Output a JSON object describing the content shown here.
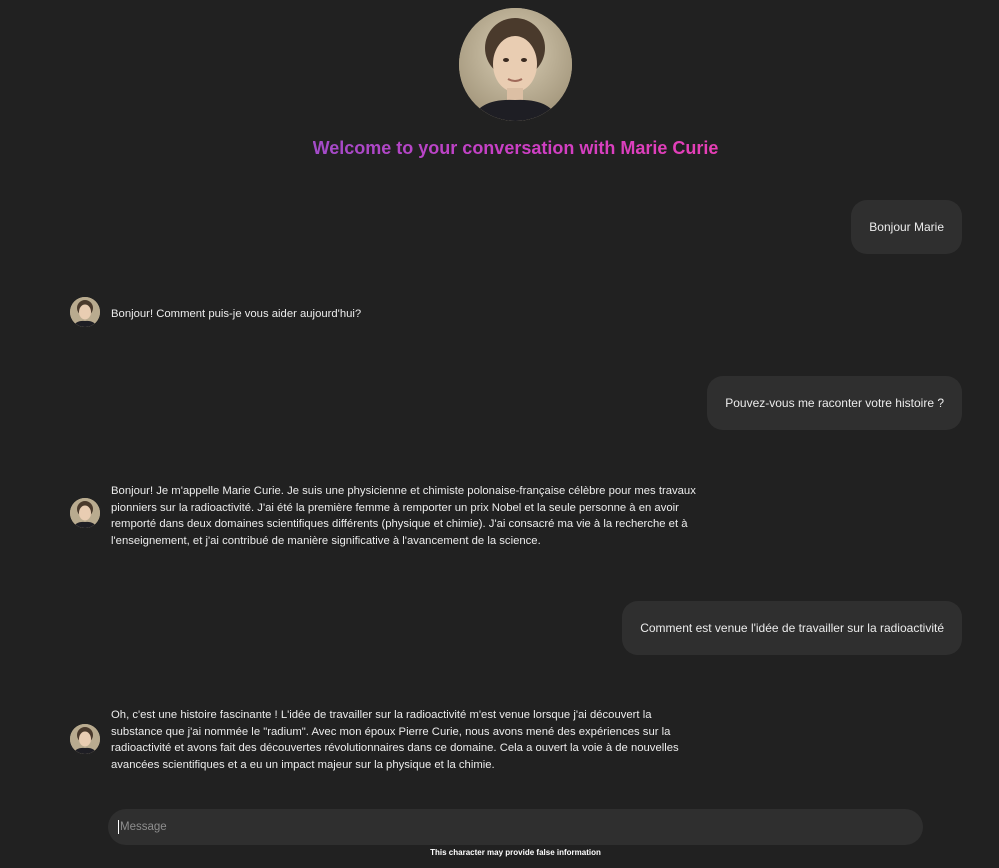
{
  "header": {
    "title": "Welcome to your conversation with Marie Curie",
    "avatar_icon": "portrait-avatar",
    "title_gradient": [
      "#a24bc8",
      "#e83fb6"
    ]
  },
  "messages": [
    {
      "role": "user",
      "text": "Bonjour Marie"
    },
    {
      "role": "assistant",
      "text": "Bonjour! Comment puis-je vous aider aujourd'hui?"
    },
    {
      "role": "user",
      "text": "Pouvez-vous me raconter votre histoire ?"
    },
    {
      "role": "assistant",
      "text": "Bonjour! Je m'appelle Marie Curie. Je suis une physicienne et chimiste polonaise-française célèbre pour mes travaux pionniers sur la radioactivité. J'ai été la première femme à remporter un prix Nobel et la seule personne à en avoir remporté dans deux domaines scientifiques différents (physique et chimie). J'ai consacré ma vie à la recherche et à l'enseignement, et j'ai contribué de manière significative à l'avancement de la science."
    },
    {
      "role": "user",
      "text": "Comment est venue l'idée de travailler sur la radioactivité"
    },
    {
      "role": "assistant",
      "text": "Oh, c'est une histoire fascinante ! L'idée de travailler sur la radioactivité m'est venue lorsque j'ai découvert la substance que j'ai nommée le \"radium\". Avec mon époux Pierre Curie, nous avons mené des expériences sur la radioactivité et avons fait des découvertes révolutionnaires dans ce domaine. Cela a ouvert la voie à de nouvelles avancées scientifiques et a eu un impact majeur sur la physique et la chimie."
    }
  ],
  "composer": {
    "placeholder": "Message",
    "value": ""
  },
  "footer": {
    "disclaimer": "This character may provide false information"
  },
  "colors": {
    "background": "#212121",
    "bubble": "#2f2f2f",
    "text": "#ececec"
  }
}
